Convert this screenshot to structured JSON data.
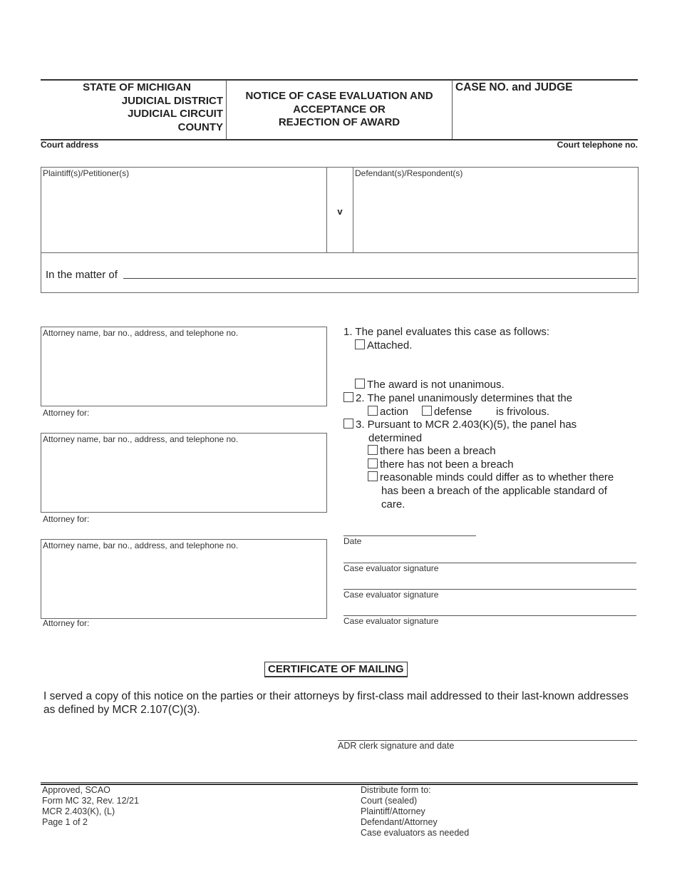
{
  "header": {
    "court_lines": [
      "STATE OF MICHIGAN",
      "JUDICIAL DISTRICT",
      "JUDICIAL CIRCUIT",
      "COUNTY"
    ],
    "title_lines": [
      "NOTICE OF CASE EVALUATION AND",
      "ACCEPTANCE OR",
      "REJECTION OF AWARD"
    ],
    "case_no_label": "CASE NO. and JUDGE",
    "court_address_label": "Court address",
    "court_phone_label": "Court telephone no."
  },
  "parties": {
    "plaintiff_label": "Plaintiff(s)/Petitioner(s)",
    "versus": "v",
    "defendant_label": "Defendant(s)/Respondent(s)",
    "matter_label": "In the matter of"
  },
  "attorneys": [
    {
      "box_label": "Attorney name, bar no., address, and telephone no.",
      "for_label": "Attorney for:"
    },
    {
      "box_label": "Attorney name, bar no., address, and telephone no.",
      "for_label": "Attorney for:"
    },
    {
      "box_label": "Attorney name, bar no., address, and telephone no.",
      "for_label": "Attorney for:"
    }
  ],
  "evaluation": {
    "item1": "1. The panel evaluates this case as follows:",
    "attached": "Attached.",
    "not_unanimous": "The award is not unanimous.",
    "item2": "2. The panel unanimously determines that the",
    "action": "action",
    "defense": "defense",
    "frivolous": "is frivolous.",
    "item3_line1": "3. Pursuant to MCR 2.403(K)(5), the panel has",
    "item3_line2": "determined",
    "breach": "there has been a breach",
    "no_breach": "there has not been a breach",
    "differ_line1": "reasonable minds could differ as to whether there",
    "differ_line2": "has been a breach of the applicable standard of",
    "differ_line3": "care."
  },
  "checkboxes": {
    "attached": false,
    "not_unanimous": false,
    "item2": false,
    "action": false,
    "defense": false,
    "item3": false,
    "breach": false,
    "no_breach": false,
    "differ": false
  },
  "signatures": {
    "date_label": "Date",
    "evaluator_labels": [
      "Case evaluator signature",
      "Case evaluator signature",
      "Case evaluator signature"
    ]
  },
  "certificate": {
    "title": "CERTIFICATE OF MAILING",
    "text": "I served a copy of this notice on the parties or their attorneys by first-class mail addressed to their last-known addresses as defined by MCR 2.107(C)(3).",
    "clerk_label": "ADR clerk signature and date"
  },
  "footer": {
    "left": [
      "Approved, SCAO",
      "Form MC 32, Rev. 12/21",
      "MCR 2.403(K), (L)",
      "Page 1 of 2"
    ],
    "right": [
      "Distribute form to:",
      "Court (sealed)",
      "Plaintiff/Attorney",
      "Defendant/Attorney",
      "Case evaluators as needed"
    ]
  }
}
